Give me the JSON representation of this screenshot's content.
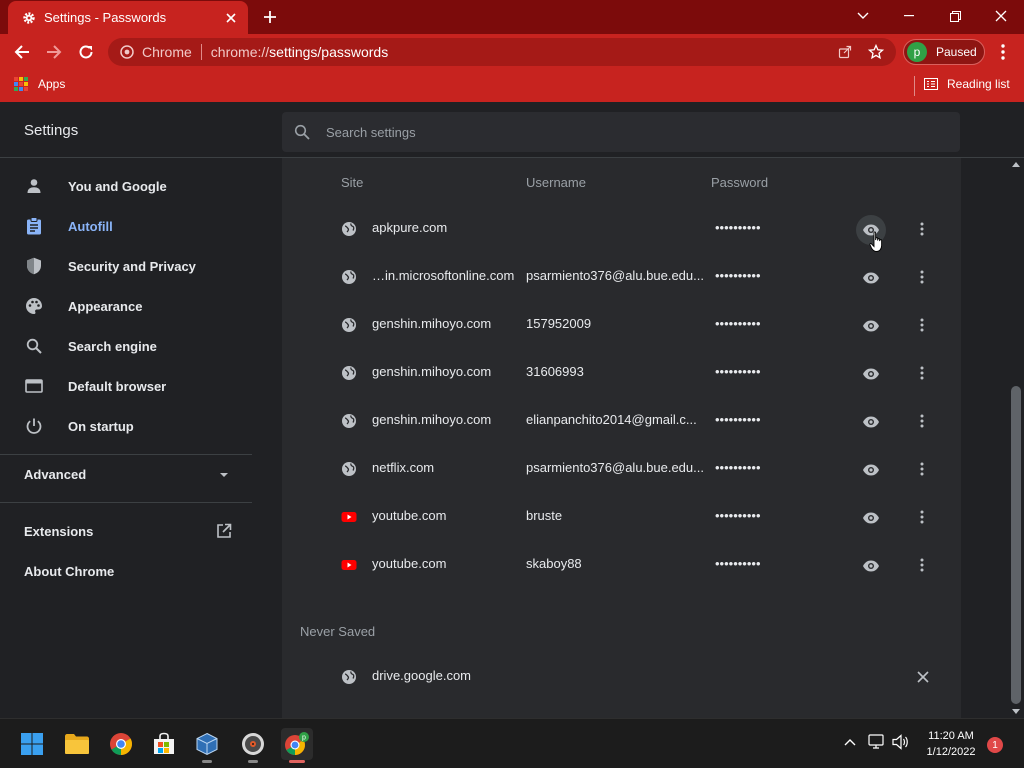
{
  "browser": {
    "tab_title": "Settings - Passwords",
    "omnibox_origin": "Chrome",
    "url_prefix": "chrome://",
    "url_path": "settings/passwords",
    "profile_initial": "p",
    "profile_status": "Paused",
    "bookmarks": {
      "apps_label": "Apps",
      "reading_list_label": "Reading list"
    },
    "colors": {
      "frame": "#7c0b0b",
      "toolbar": "#c7231f"
    }
  },
  "settings": {
    "title": "Settings",
    "search_placeholder": "Search settings",
    "sidebar": {
      "items": [
        {
          "label": "You and Google",
          "icon": "person-icon",
          "active": false
        },
        {
          "label": "Autofill",
          "icon": "clipboard-icon",
          "active": true
        },
        {
          "label": "Security and Privacy",
          "icon": "shield-icon",
          "active": false
        },
        {
          "label": "Appearance",
          "icon": "palette-icon",
          "active": false
        },
        {
          "label": "Search engine",
          "icon": "search-icon",
          "active": false
        },
        {
          "label": "Default browser",
          "icon": "browser-window-icon",
          "active": false
        },
        {
          "label": "On startup",
          "icon": "power-icon",
          "active": false
        }
      ],
      "advanced_label": "Advanced",
      "extensions_label": "Extensions",
      "about_label": "About Chrome"
    },
    "passwords": {
      "columns": {
        "site": "Site",
        "username": "Username",
        "password": "Password"
      },
      "rows": [
        {
          "site": "apkpure.com",
          "username": "",
          "password": "••••••••••",
          "icon": "globe-icon"
        },
        {
          "site": "…in.microsoftonline.com",
          "username": "psarmiento376@alu.bue.edu...",
          "password": "••••••••••",
          "icon": "globe-icon"
        },
        {
          "site": "genshin.mihoyo.com",
          "username": "157952009",
          "password": "••••••••••",
          "icon": "globe-icon"
        },
        {
          "site": "genshin.mihoyo.com",
          "username": "31606993",
          "password": "••••••••••",
          "icon": "globe-icon"
        },
        {
          "site": "genshin.mihoyo.com",
          "username": "elianpanchito2014@gmail.c...",
          "password": "••••••••••",
          "icon": "globe-icon"
        },
        {
          "site": "netflix.com",
          "username": "psarmiento376@alu.bue.edu...",
          "password": "••••••••••",
          "icon": "globe-icon"
        },
        {
          "site": "youtube.com",
          "username": "bruste",
          "password": "••••••••••",
          "icon": "youtube-icon"
        },
        {
          "site": "youtube.com",
          "username": "skaboy88",
          "password": "••••••••••",
          "icon": "youtube-icon"
        }
      ],
      "never_saved_label": "Never Saved",
      "never_saved": [
        {
          "site": "drive.google.com",
          "icon": "globe-icon"
        }
      ]
    }
  },
  "taskbar": {
    "apps": [
      "windows-start-icon",
      "file-explorer-icon",
      "chrome-icon",
      "store-icon",
      "virtualbox-icon",
      "media-player-icon",
      "chrome-profile-icon"
    ],
    "time": "11:20 AM",
    "date": "1/12/2022",
    "notification_count": "1"
  }
}
